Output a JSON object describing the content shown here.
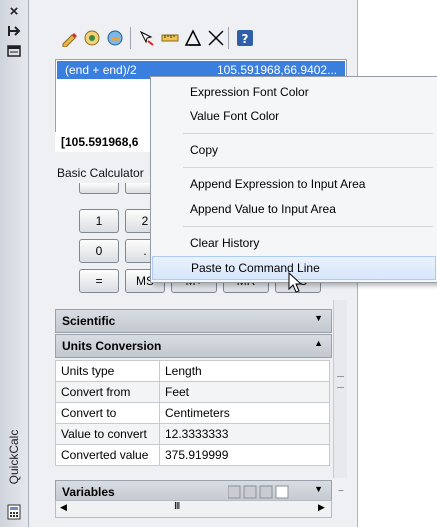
{
  "titlebar": {
    "title": "QuickCalc",
    "close_glyph": "×",
    "autohide_glyph": "⏏",
    "properties_glyph": "▤"
  },
  "toolbar": {
    "icons": [
      "clear-icon",
      "history-icon",
      "command-line-icon",
      "get-coordinates-icon",
      "distance-icon",
      "angle-icon",
      "intersection-icon",
      "help-icon"
    ]
  },
  "history": {
    "expression": "(end + end)/2",
    "value": "105.591968,66.9402..."
  },
  "input": {
    "value": "[105.591968,6"
  },
  "basic": {
    "label": "Basic Calculator",
    "buttons": [
      "1",
      "2",
      "0",
      ".",
      "=",
      "MS",
      "M+",
      "MR",
      "MC"
    ]
  },
  "sections": {
    "scientific": "Scientific",
    "units": "Units Conversion",
    "variables": "Variables"
  },
  "units_table": [
    {
      "label": "Units type",
      "value": "Length"
    },
    {
      "label": "Convert from",
      "value": "Feet"
    },
    {
      "label": "Convert to",
      "value": "Centimeters"
    },
    {
      "label": "Value to convert",
      "value": "12.3333333"
    },
    {
      "label": "Converted value",
      "value": "375.919999"
    }
  ],
  "menu": {
    "items": [
      "Expression Font Color",
      "Value Font Color",
      "Copy",
      "Append Expression to Input Area",
      "Append Value to Input Area",
      "Clear History",
      "Paste to Command Line"
    ]
  },
  "hscroll": {
    "thumb": "III"
  }
}
